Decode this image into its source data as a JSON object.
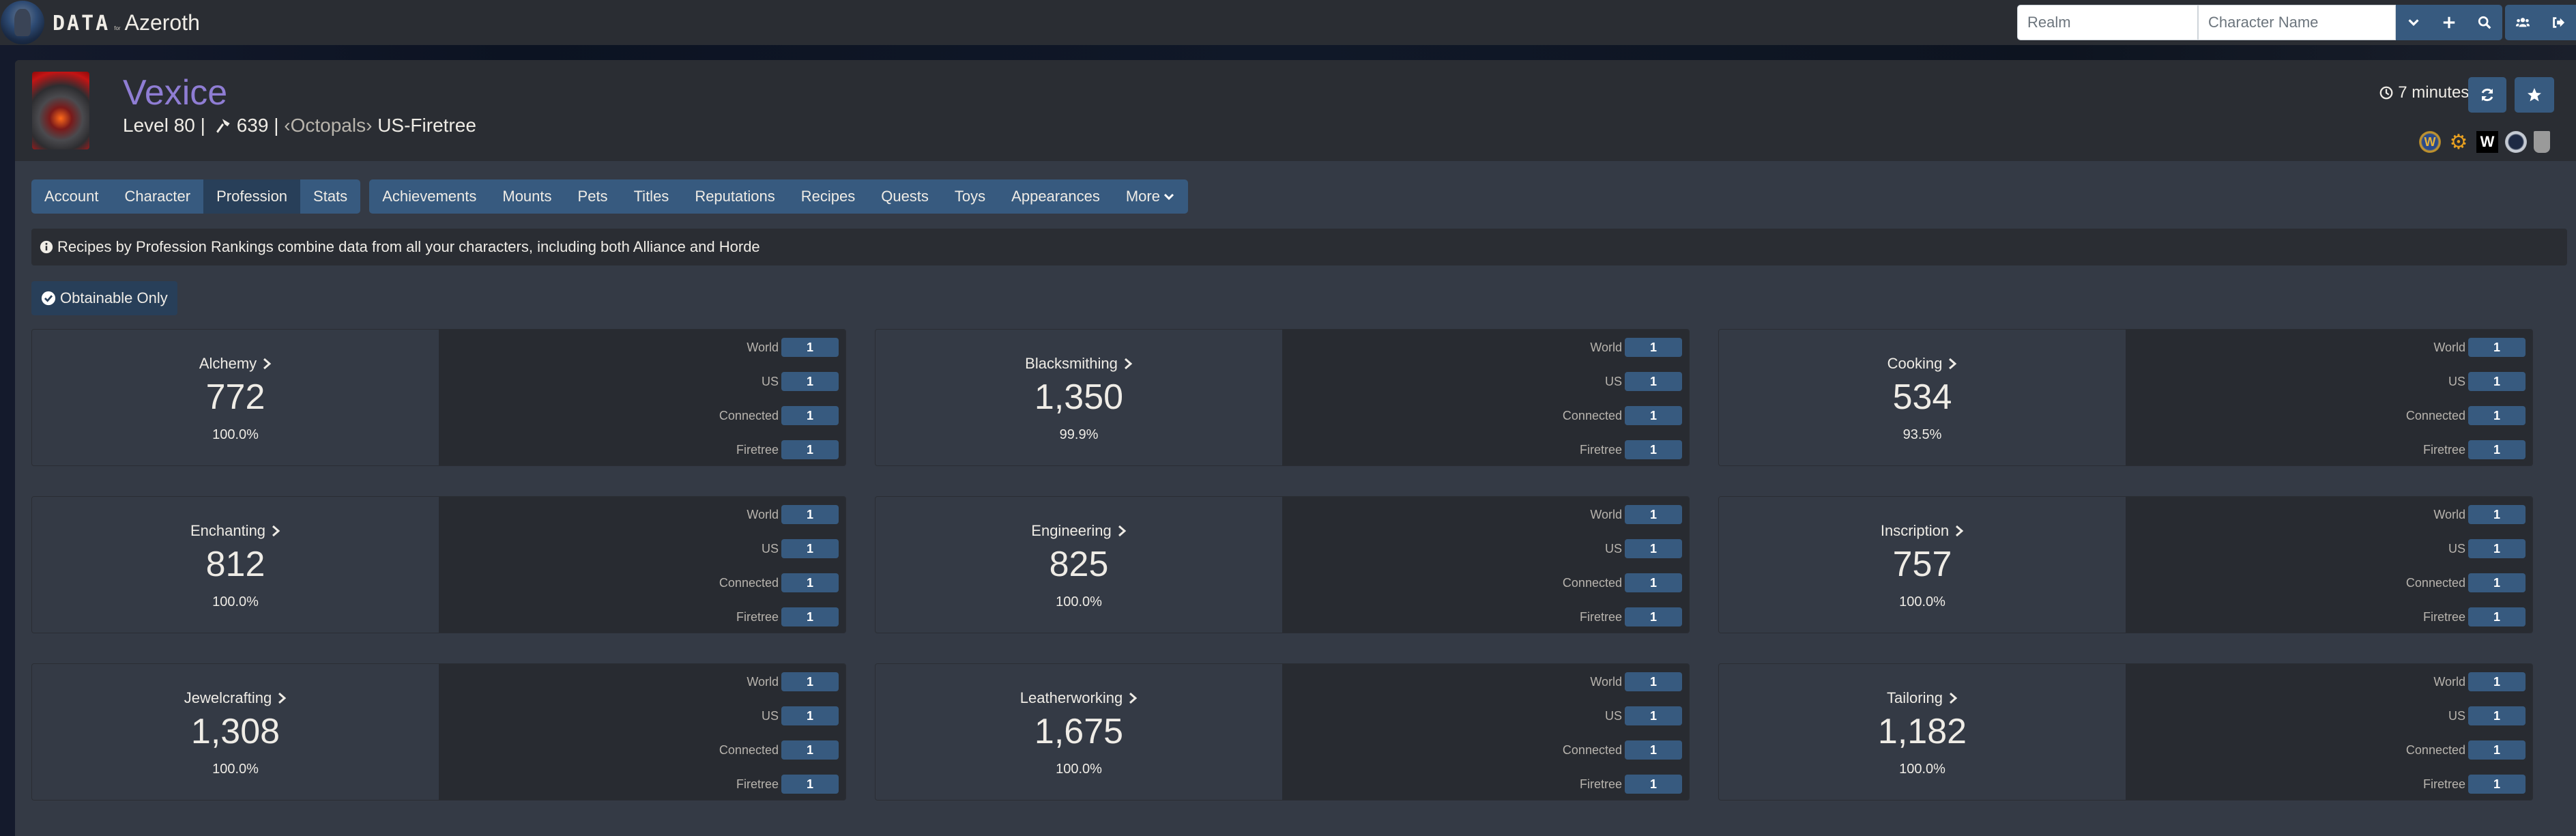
{
  "navbar": {
    "brand_data": "DATA",
    "brand_for": "for",
    "brand_name": "Azeroth",
    "realm_placeholder": "Realm",
    "character_placeholder": "Character Name",
    "icons": [
      "chevron-down-icon",
      "plus-icon",
      "search-icon",
      "users-icon",
      "sign-out-icon"
    ]
  },
  "character": {
    "name": "Vexice",
    "level_text": "Level 80 | ",
    "item_level": "639",
    "separator": " | ",
    "guild": "‹Octopals›",
    "realm": " US-Firetree",
    "updated": "7 minutes ago",
    "name_color": "#8f7dd4",
    "external_links": [
      "World of Warcraft Armory",
      "Raider.IO",
      "Wowhead",
      "Warcraft Logs",
      "WoWProgress"
    ]
  },
  "tabs": {
    "group1": [
      {
        "label": "Account",
        "active": false
      },
      {
        "label": "Character",
        "active": false
      },
      {
        "label": "Profession",
        "active": true
      },
      {
        "label": "Stats",
        "active": false
      }
    ],
    "group2": [
      {
        "label": "Achievements"
      },
      {
        "label": "Mounts"
      },
      {
        "label": "Pets"
      },
      {
        "label": "Titles"
      },
      {
        "label": "Reputations"
      },
      {
        "label": "Recipes"
      },
      {
        "label": "Quests"
      },
      {
        "label": "Toys"
      },
      {
        "label": "Appearances"
      },
      {
        "label": "More"
      }
    ]
  },
  "info": "Recipes by Profession Rankings combine data from all your characters, including both Alliance and Horde",
  "filter": {
    "label": "Obtainable Only",
    "checked": true
  },
  "rank_labels": [
    "World",
    "US",
    "Connected",
    "Firetree"
  ],
  "professions": [
    {
      "name": "Alchemy",
      "count": "772",
      "percent": "100.0%",
      "ranks": [
        "1",
        "1",
        "1",
        "1"
      ]
    },
    {
      "name": "Blacksmithing",
      "count": "1,350",
      "percent": "99.9%",
      "ranks": [
        "1",
        "1",
        "1",
        "1"
      ]
    },
    {
      "name": "Cooking",
      "count": "534",
      "percent": "93.5%",
      "ranks": [
        "1",
        "1",
        "1",
        "1"
      ]
    },
    {
      "name": "Enchanting",
      "count": "812",
      "percent": "100.0%",
      "ranks": [
        "1",
        "1",
        "1",
        "1"
      ]
    },
    {
      "name": "Engineering",
      "count": "825",
      "percent": "100.0%",
      "ranks": [
        "1",
        "1",
        "1",
        "1"
      ]
    },
    {
      "name": "Inscription",
      "count": "757",
      "percent": "100.0%",
      "ranks": [
        "1",
        "1",
        "1",
        "1"
      ]
    },
    {
      "name": "Jewelcrafting",
      "count": "1,308",
      "percent": "100.0%",
      "ranks": [
        "1",
        "1",
        "1",
        "1"
      ]
    },
    {
      "name": "Leatherworking",
      "count": "1,675",
      "percent": "100.0%",
      "ranks": [
        "1",
        "1",
        "1",
        "1"
      ]
    },
    {
      "name": "Tailoring",
      "count": "1,182",
      "percent": "100.0%",
      "ranks": [
        "1",
        "1",
        "1",
        "1"
      ]
    }
  ],
  "colors": {
    "accent": "#375a7f",
    "accent_active": "#283f59",
    "panel": "#343a45",
    "dark": "#2a2d33"
  }
}
